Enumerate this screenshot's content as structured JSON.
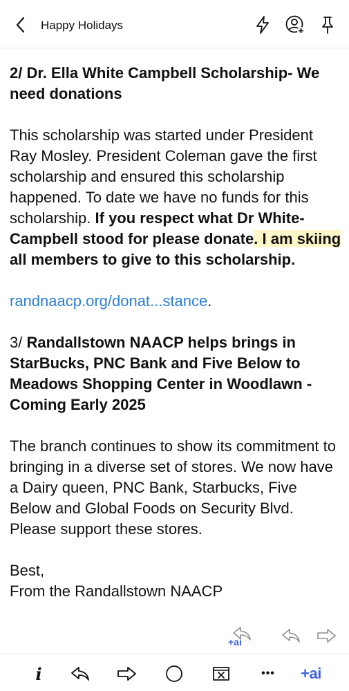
{
  "header": {
    "title": "Happy Holidays"
  },
  "email": {
    "section2_heading": "2/  Dr. Ella White Campbell Scholarship- We need donations",
    "section2_body_plain": "This scholarship was started under President Ray Mosley. President Coleman gave the first scholarship and ensured this scholarship happened. To date we have no funds for this scholarship. ",
    "section2_body_bold_a": "If you respect what Dr White-Campbell stood for please donate",
    "section2_body_bold_highlight": ". I am skiing",
    "section2_body_bold_b": " all members to give to this scholarship.",
    "donation_link": "randnaacp.org/donat...stance",
    "donation_link_suffix": ".",
    "section3_prefix": "3/ ",
    "section3_heading": "Randallstown NAACP helps brings in StarBucks, PNC Bank and Five Below to Meadows Shopping Center in Woodlawn -Coming Early 2025",
    "section3_body": "The branch continues to show its commitment to bringing in a diverse set of stores. We now have a Dairy queen, PNC Bank, Starbucks, Five Below and Global Foods on Security Blvd. Please support these stores.",
    "signoff": "Best,",
    "signature": "From the Randallstown NAACP"
  },
  "message_actions": {
    "ai_label": "+ai"
  },
  "toolbar": {
    "info_label": "i",
    "more_label": "•••",
    "ai_label": "+ai"
  },
  "colors": {
    "link": "#2e7fd9",
    "highlight": "#fdf6c8",
    "ai_accent": "#3f63e0",
    "icon_gray": "#8e8e93"
  },
  "icons": [
    "back-chevron-icon",
    "flash-icon",
    "add-contact-icon",
    "pin-icon",
    "ai-reply-icon",
    "reply-icon",
    "forward-icon",
    "info-icon",
    "reply-icon",
    "forward-icon",
    "circle-icon",
    "archive-x-icon",
    "more-icon",
    "ai-icon"
  ]
}
